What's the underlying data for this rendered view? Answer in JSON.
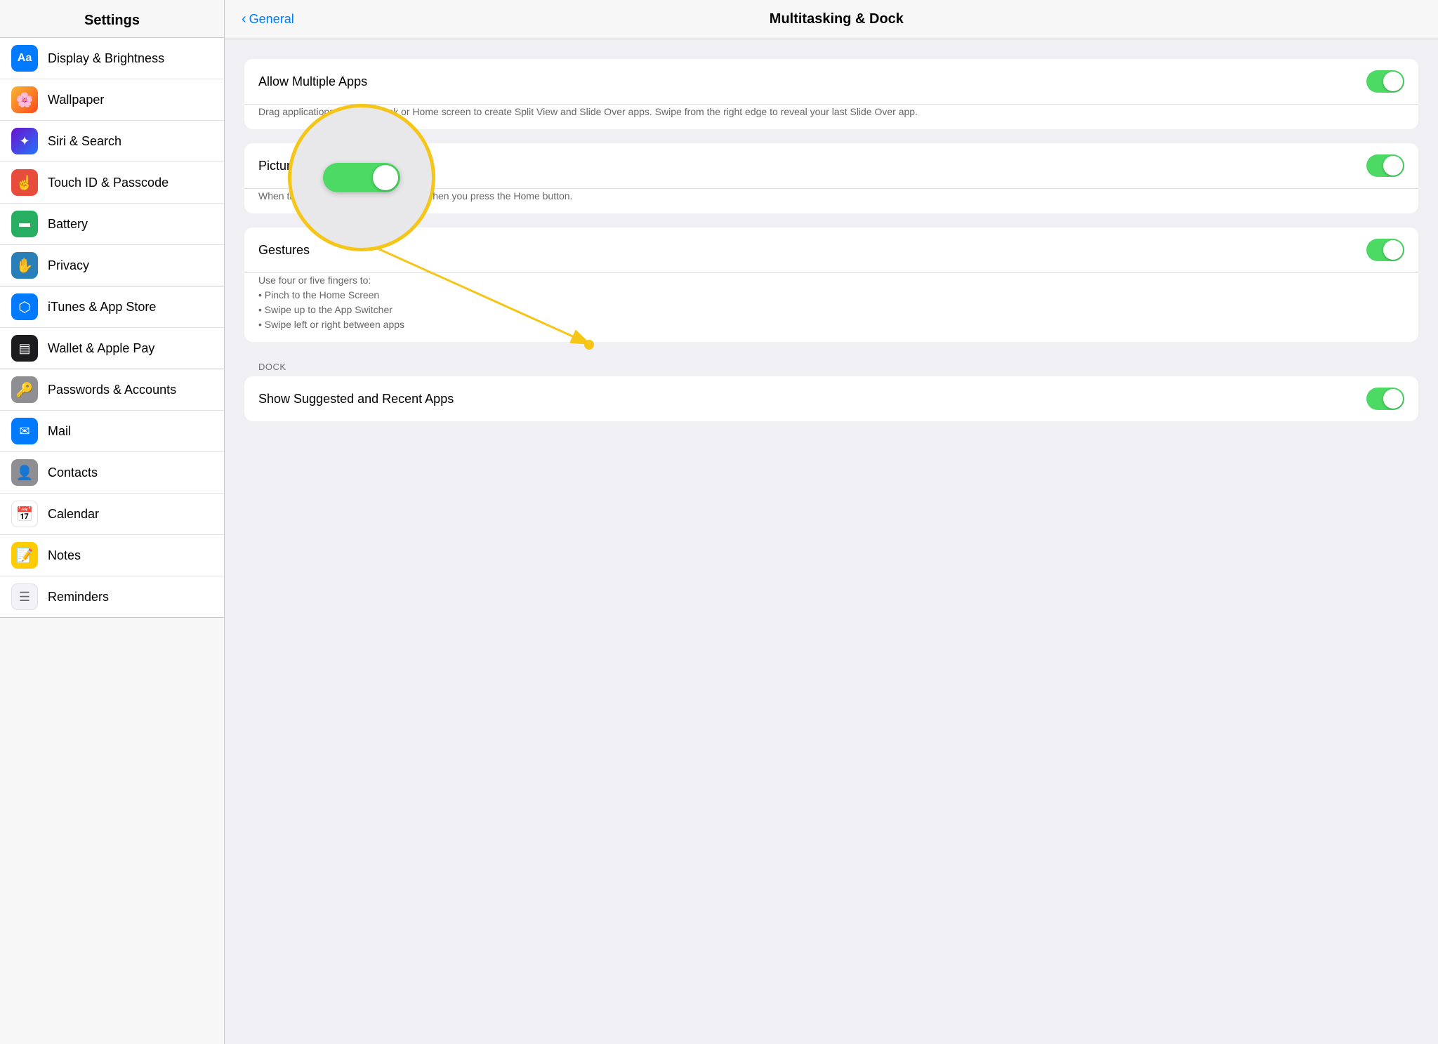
{
  "sidebar": {
    "title": "Settings",
    "items_group1": [
      {
        "id": "display-brightness",
        "label": "Display & Brightness",
        "icon_bg": "#007aff",
        "icon": "Aa"
      },
      {
        "id": "wallpaper",
        "label": "Wallpaper",
        "icon_bg": "#ff6b6b",
        "icon": "🌸"
      },
      {
        "id": "siri-search",
        "label": "Siri & Search",
        "icon_bg": "#8e44ad",
        "icon": "◈"
      },
      {
        "id": "touch-id",
        "label": "Touch ID & Passcode",
        "icon_bg": "#e74c3c",
        "icon": "◉"
      },
      {
        "id": "battery",
        "label": "Battery",
        "icon_bg": "#27ae60",
        "icon": "▬"
      },
      {
        "id": "privacy",
        "label": "Privacy",
        "icon_bg": "#2980b9",
        "icon": "✋"
      }
    ],
    "items_group2": [
      {
        "id": "itunes",
        "label": "iTunes & App Store",
        "icon_bg": "#007aff",
        "icon": "⬡"
      },
      {
        "id": "wallet",
        "label": "Wallet & Apple Pay",
        "icon_bg": "#2c2c2e",
        "icon": "▤"
      }
    ],
    "items_group3": [
      {
        "id": "passwords",
        "label": "Passwords & Accounts",
        "icon_bg": "#8e8e93",
        "icon": "🔑"
      },
      {
        "id": "mail",
        "label": "Mail",
        "icon_bg": "#007aff",
        "icon": "✉"
      },
      {
        "id": "contacts",
        "label": "Contacts",
        "icon_bg": "#8e8e93",
        "icon": "👤"
      },
      {
        "id": "calendar",
        "label": "Calendar",
        "icon_bg": "#ff3b30",
        "icon": "📅"
      },
      {
        "id": "notes",
        "label": "Notes",
        "icon_bg": "#ffcc00",
        "icon": "📝"
      },
      {
        "id": "reminders",
        "label": "Reminders",
        "icon_bg": "#f2f2f7",
        "icon": "☰"
      }
    ]
  },
  "header": {
    "back_label": "General",
    "title": "Multitasking & Dock"
  },
  "content": {
    "card1": {
      "rows": [
        {
          "id": "allow-multiple",
          "label": "Allow Multiple Apps",
          "toggle": true,
          "desc": "Drag applications from the Dock or Home screen to create Split View and Slide Over apps. Swipe from the right edge to reveal your last Slide Over app."
        }
      ]
    },
    "card2": {
      "rows": [
        {
          "id": "picture-in-picture",
          "label": "Picture in Picture",
          "toggle": true,
          "desc": "When this is on, videos will co… even when you press the Home button."
        }
      ]
    },
    "card3": {
      "rows": [
        {
          "id": "gestures",
          "label": "Gestures",
          "toggle": true,
          "desc": "Use four or five fingers to:\n• Pinch to the Home Screen\n• Swipe up to the App Switcher\n• Swipe left or right between apps"
        }
      ]
    },
    "dock_section": {
      "header": "DOCK",
      "rows": [
        {
          "id": "suggested-recent",
          "label": "Show Suggested and Recent Apps",
          "toggle": true
        }
      ]
    }
  }
}
